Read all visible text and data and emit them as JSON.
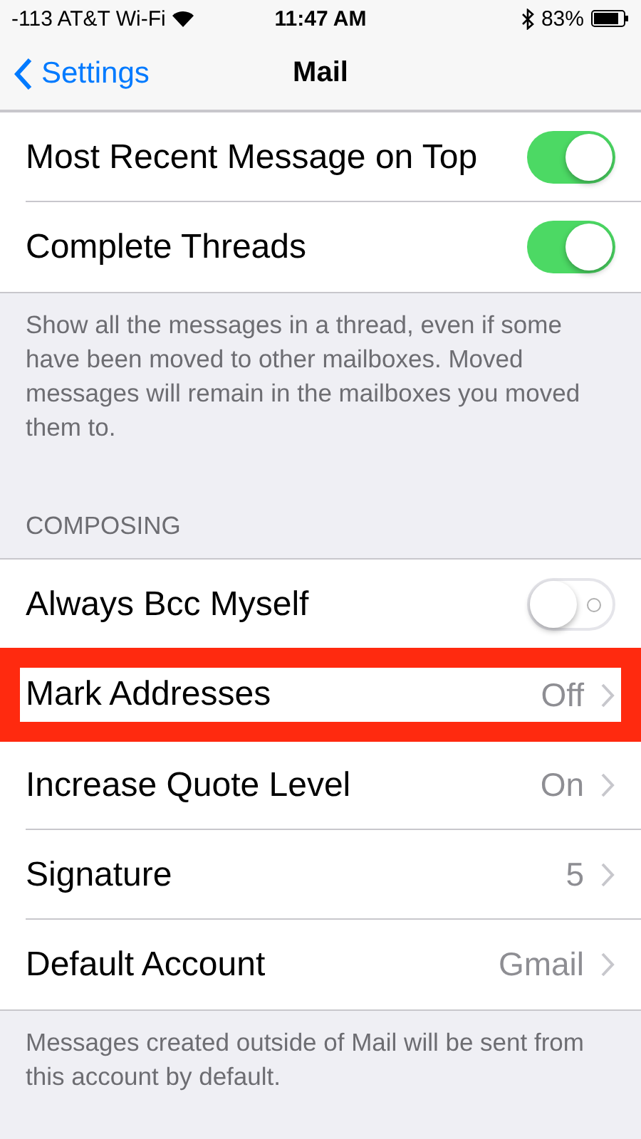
{
  "status_bar": {
    "carrier": "-113 AT&T Wi-Fi",
    "time": "11:47 AM",
    "battery": "83%"
  },
  "nav": {
    "back": "Settings",
    "title": "Mail"
  },
  "groups": [
    {
      "rows": [
        {
          "kind": "toggle",
          "label": "Most Recent Message on Top",
          "on": true
        },
        {
          "kind": "toggle",
          "label": "Complete Threads",
          "on": true
        }
      ],
      "footer": "Show all the messages in a thread, even if some have been moved to other mailboxes. Moved messages will remain in the mailboxes you moved them to."
    },
    {
      "header": "COMPOSING",
      "rows": [
        {
          "kind": "toggle",
          "label": "Always Bcc Myself",
          "on": false
        },
        {
          "kind": "link",
          "label": "Mark Addresses",
          "value": "Off",
          "highlighted": true
        },
        {
          "kind": "link",
          "label": "Increase Quote Level",
          "value": "On",
          "highlighted": false
        },
        {
          "kind": "link",
          "label": "Signature",
          "value": "5",
          "highlighted": false
        },
        {
          "kind": "link",
          "label": "Default Account",
          "value": "Gmail",
          "highlighted": false
        }
      ],
      "footer": "Messages created outside of Mail will be sent from this account by default."
    }
  ]
}
